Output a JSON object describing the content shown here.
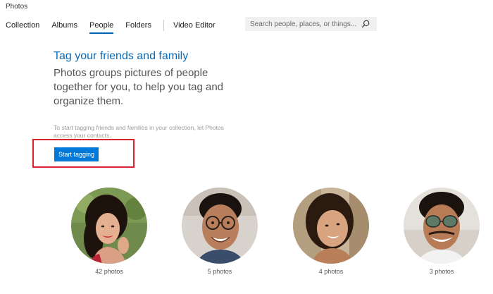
{
  "app": {
    "title": "Photos"
  },
  "nav": {
    "items": [
      {
        "label": "Collection",
        "active": false
      },
      {
        "label": "Albums",
        "active": false
      },
      {
        "label": "People",
        "active": true
      },
      {
        "label": "Folders",
        "active": false
      },
      {
        "label": "Video Editor",
        "active": false
      }
    ]
  },
  "search": {
    "placeholder": "Search people, places, or things...",
    "value": ""
  },
  "intro": {
    "heading": "Tag your friends and family",
    "description": "Photos groups pictures of people together for you, to help you tag and organize them.",
    "hint": "To start tagging friends and families in your collection, let Photos access your contacts.",
    "button_label": "Start tagging"
  },
  "people": [
    {
      "count_label": "42 photos",
      "icon": "woman-portrait"
    },
    {
      "count_label": "5 photos",
      "icon": "man-glasses-portrait"
    },
    {
      "count_label": "4 photos",
      "icon": "woman-portrait"
    },
    {
      "count_label": "3 photos",
      "icon": "man-sunglasses-portrait"
    }
  ],
  "colors": {
    "accent": "#0078d7",
    "heading": "#0a6ab8",
    "highlight": "#d9232e"
  }
}
